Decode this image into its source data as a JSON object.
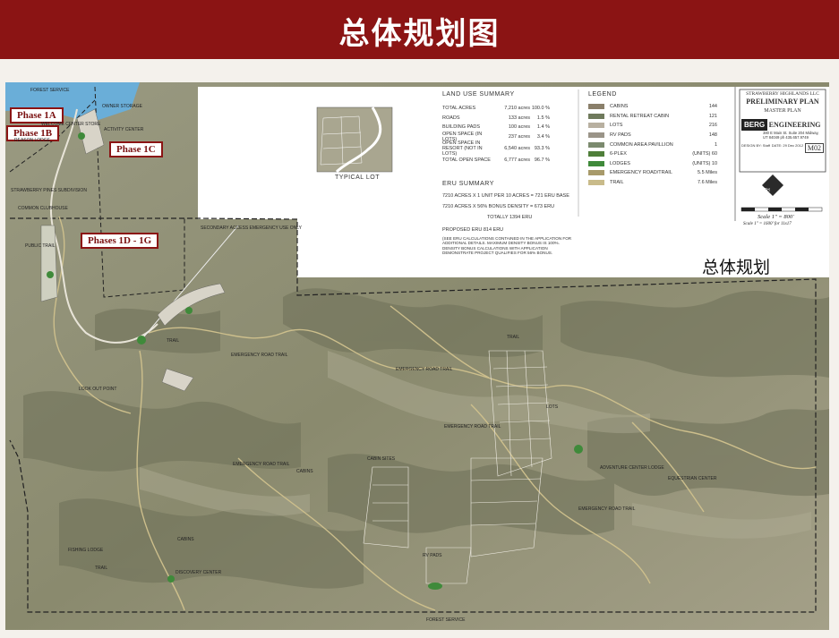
{
  "header": {
    "title": "总体规划图"
  },
  "phases": [
    "Phase 1A",
    "Phase 1B",
    "Phase 1C",
    "Phases 1D - 1G"
  ],
  "map_labels": {
    "forest_service_top": "FOREST SERVICE",
    "forest_service_bottom": "FOREST SERVICE",
    "welcome_center": "WELCOME CENTER STORE",
    "trail_lodge": "TRAIL LODGE",
    "reason_lodge": "REASON LODGE",
    "activity_center": "ACTIVITY CENTER",
    "owner_storage": "OWNER STORAGE",
    "strawberry_pines": "STRAWBERRY PINES SUBDIVISION",
    "common_clubhouse": "COMMON CLUBHOUSE",
    "public_trail": "PUBLIC TRAIL",
    "secondary_access": "SECONDARY ACCESS EMERGENCY USE ONLY",
    "emergency_road_trail": "EMERGENCY ROAD TRAIL",
    "look_out_point": "LOOK OUT POINT",
    "fishing_lodge": "FISHING LODGE",
    "discovery_center": "DISCOVERY CENTER",
    "cabin_sites": "CABIN SITES",
    "rv_pads": "RV PADS",
    "lots": "LOTS",
    "adventure_center": "ADVENTURE CENTER LODGE",
    "equestrian_center": "EQUESTRIAN CENTER",
    "trail": "TRAIL",
    "cabins": "CABINS"
  },
  "typical_lot": {
    "label": "TYPICAL LOT"
  },
  "land_use": {
    "title": "LAND USE SUMMARY",
    "rows": [
      {
        "name": "TOTAL ACRES",
        "acres": "7,210 acres",
        "pct": "100.0 %"
      },
      {
        "name": "ROADS",
        "acres": "133 acres",
        "pct": "1.5 %"
      },
      {
        "name": "BUILDING PADS",
        "acres": "100 acres",
        "pct": "1.4 %"
      },
      {
        "name": "OPEN SPACE (IN LOTS)",
        "acres": "237 acres",
        "pct": "3.4 %"
      },
      {
        "name": "OPEN SPACE IN RESORT (NOT IN LOTS)",
        "acres": "6,540 acres",
        "pct": "93.3 %"
      },
      {
        "name": "TOTAL OPEN SPACE",
        "acres": "6,777 acres",
        "pct": "96.7 %"
      }
    ]
  },
  "eru": {
    "title": "ERU SUMMARY",
    "lines": [
      "7210 ACRES X 1 UNIT PER 10 ACRES = 721 ERU BASE",
      "7210 ACRES X 56% BONUS DENSITY = 673 ERU",
      "TOTALLY 1394 ERU",
      "PROPOSED ERU 814 ERU",
      "(SEE ERU CALCULATIONS CONTAINED IN THE APPLICATION FOR ADDITIONAL DETAILS. MAXIMUM DENSITY BONUS IS 100%. DENSITY BONUS CALCULATIONS WITH APPLICATION DEMONSTRATE PROJECT QUALIFIES FOR 56% BONUS."
    ]
  },
  "legend": {
    "title": "LEGEND",
    "items": [
      {
        "label": "CABINS",
        "value": "144",
        "color": "#8a7f6a"
      },
      {
        "label": "RENTAL RETREAT CABIN",
        "value": "121",
        "color": "#6f7a5c"
      },
      {
        "label": "LOTS",
        "value": "216",
        "color": "#b8b0a0"
      },
      {
        "label": "RV PADS",
        "value": "148",
        "color": "#9a9488"
      },
      {
        "label": "COMMON AREA PAVILLION",
        "value": "1",
        "color": "#7b8a6e"
      },
      {
        "label": "6-PLEX",
        "value": "(UNITS) 60",
        "color": "#4f7f3a"
      },
      {
        "label": "LODGES",
        "value": "(UNITS) 10",
        "color": "#3f8a3a"
      },
      {
        "label": "EMERGENCY ROAD/TRAIL",
        "value": "5.5 Miles",
        "color": "#a89a6a"
      },
      {
        "label": "TRAIL",
        "value": "7.6 Miles",
        "color": "#c9bb8a"
      }
    ]
  },
  "title_block": {
    "company": "STRAWBERRY HIGHLANDS LLC",
    "plan": "PRELIMINARY PLAN",
    "sheet_title": "MASTER PLAN",
    "firm_logo": "BERG",
    "firm": "ENGINEERING",
    "address": "380 E Main St. Suite 204 Midway, UT 84049 ph 435.657.9749",
    "drawn": "DESIGN BY: Staff",
    "date": "DATE: 29 Dec 2012",
    "sheet": "M02",
    "north": "NORTH",
    "scale1": "Scale 1\" = 800'",
    "scale2": "Scale 1\" = 1600' for 11x17"
  },
  "caption": "总体规划",
  "colors": {
    "header_bg": "#8b1414",
    "phase_border": "#8b1414",
    "lodge_green": "#3f8a3a"
  }
}
